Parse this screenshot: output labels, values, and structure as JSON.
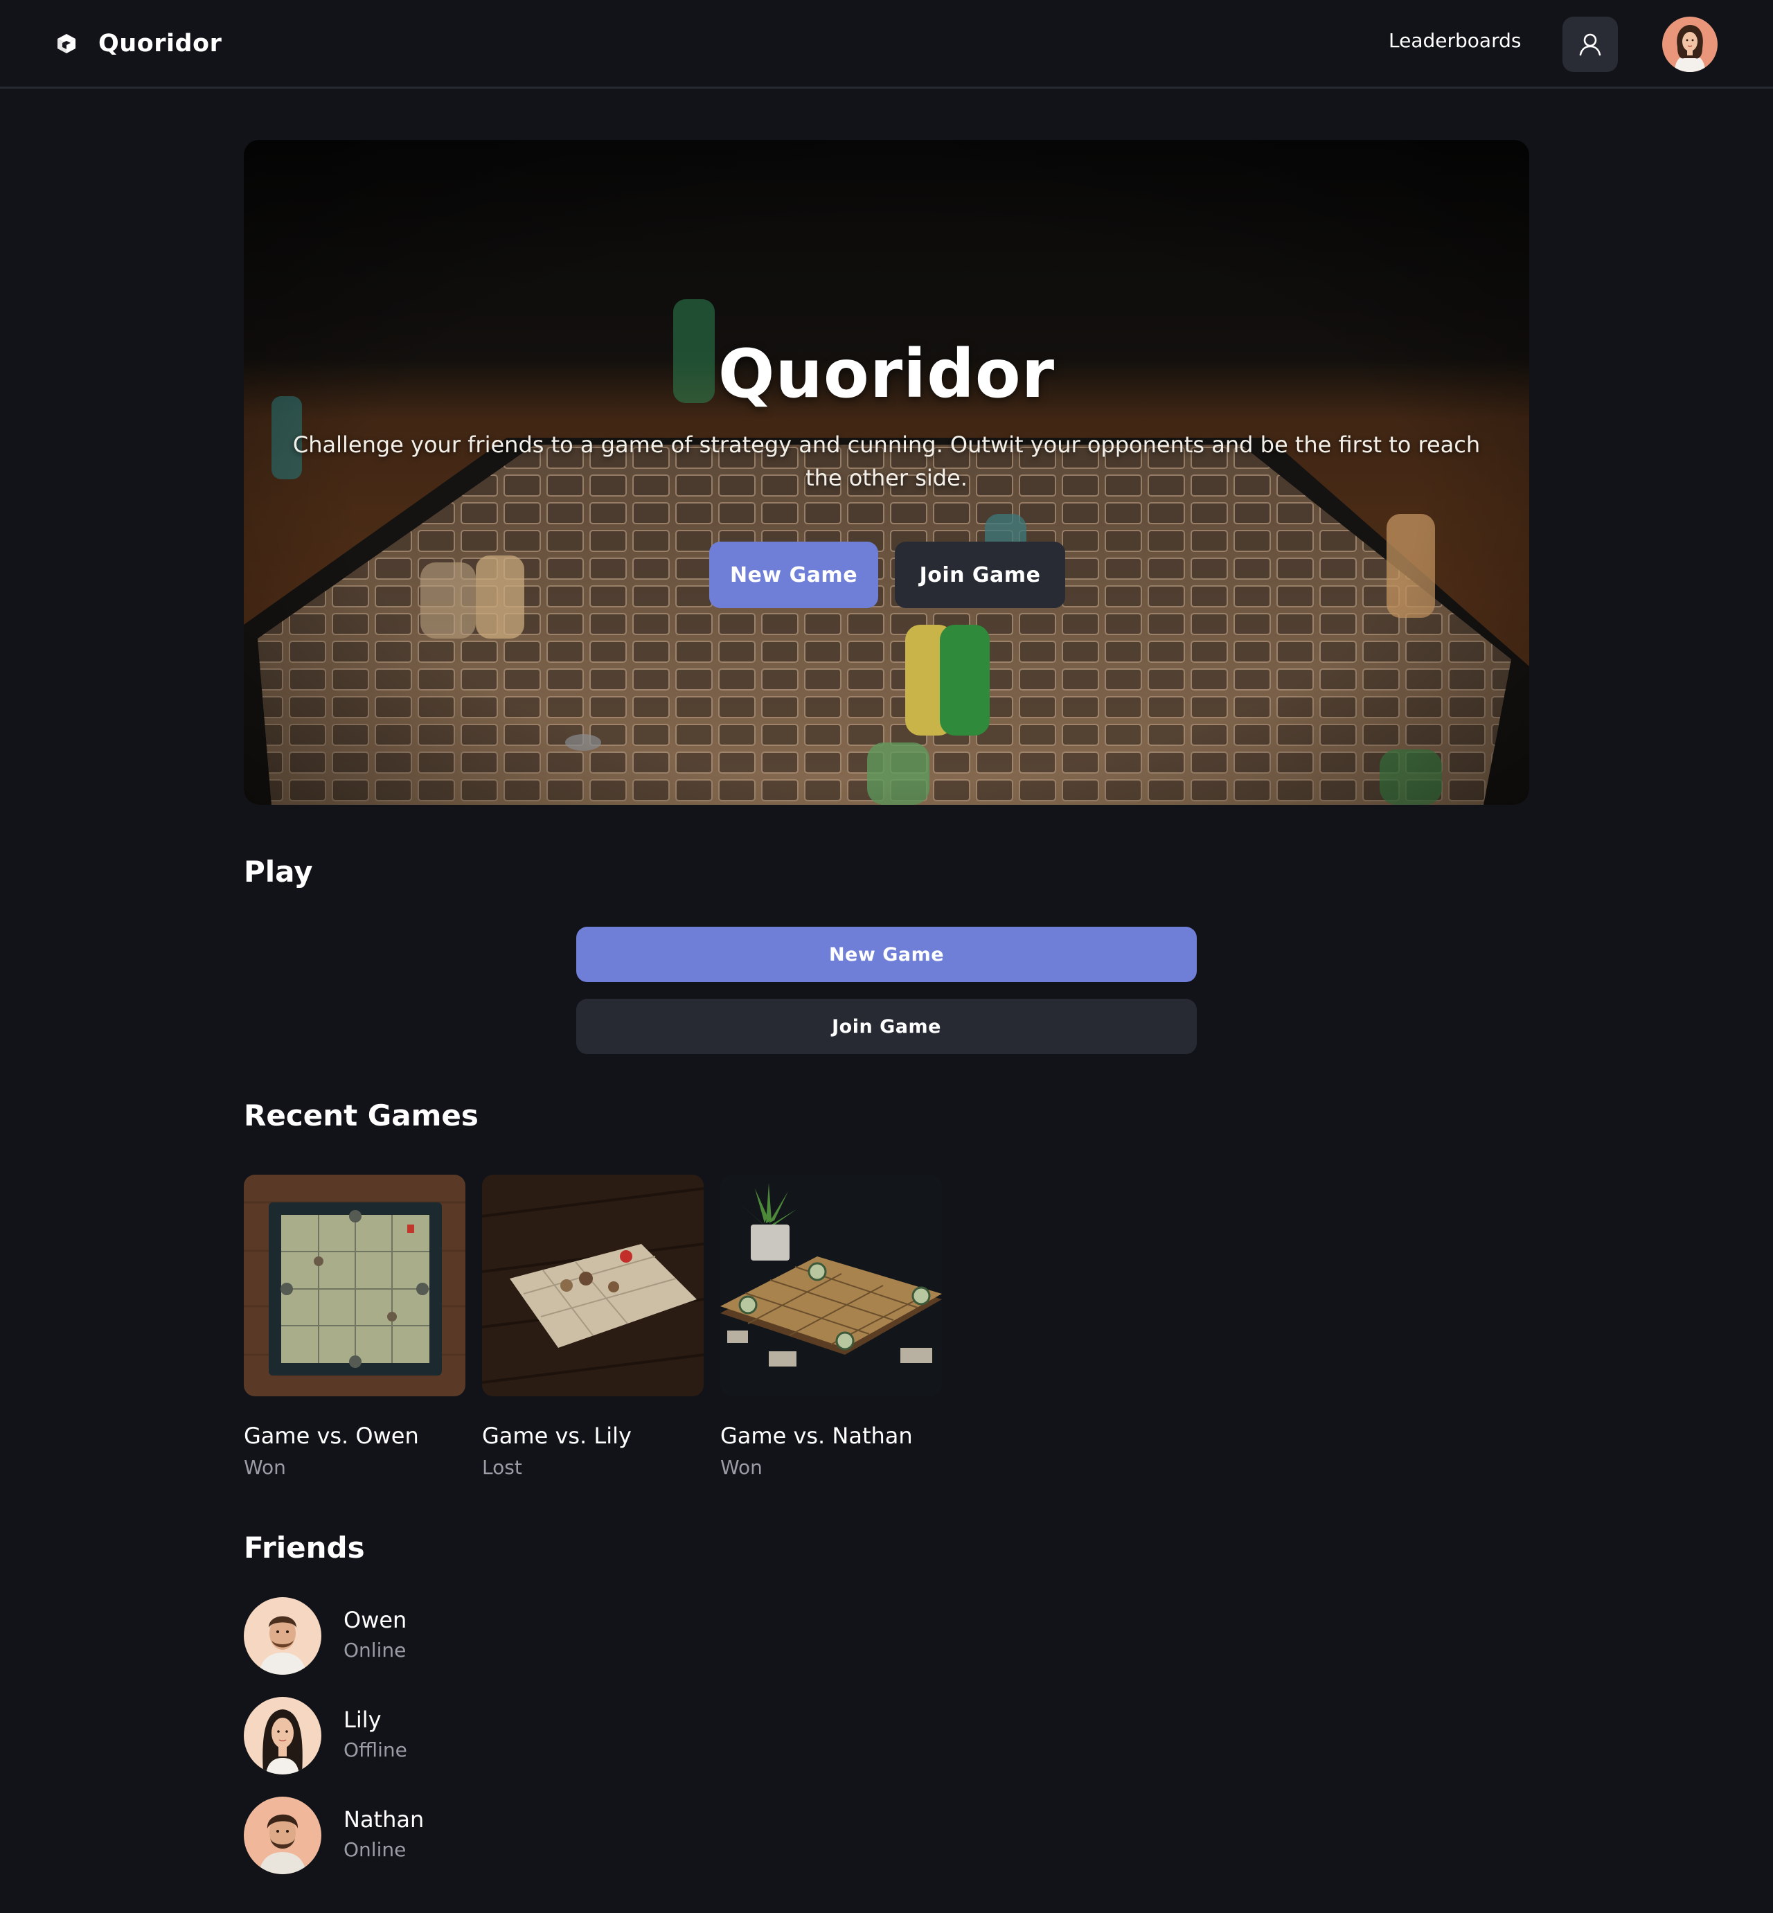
{
  "header": {
    "brand": "Quoridor",
    "nav_link": "Leaderboards",
    "brand_icon": "cube-icon",
    "user_icon": "user-icon"
  },
  "hero": {
    "title": "Quoridor",
    "subtitle": "Challenge your friends to a game of strategy and cunning. Outwit your opponents and be the first to reach the other side.",
    "new_game": "New Game",
    "join_game": "Join Game"
  },
  "play": {
    "title": "Play",
    "new_game": "New Game",
    "join_game": "Join Game"
  },
  "recent": {
    "title": "Recent Games",
    "games": [
      {
        "title": "Game vs. Owen",
        "result": "Won"
      },
      {
        "title": "Game vs. Lily",
        "result": "Lost"
      },
      {
        "title": "Game vs. Nathan",
        "result": "Won"
      }
    ]
  },
  "friends": {
    "title": "Friends",
    "items": [
      {
        "name": "Owen",
        "status": "Online"
      },
      {
        "name": "Lily",
        "status": "Offline"
      },
      {
        "name": "Nathan",
        "status": "Online"
      }
    ]
  },
  "colors": {
    "background": "#111318",
    "accent": "#6f7fd8",
    "secondary_button": "#282b34",
    "muted_text": "#9a9ca6"
  }
}
